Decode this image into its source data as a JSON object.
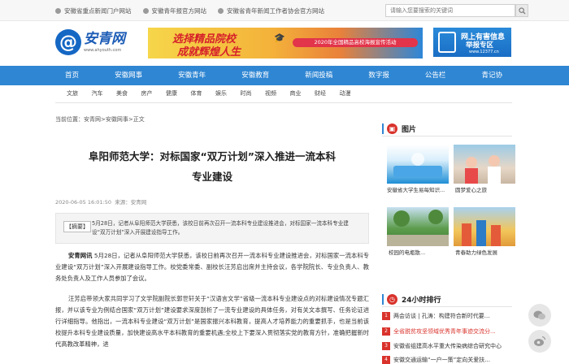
{
  "topbar": {
    "links": [
      {
        "label": "安徽省重点新闻门户网站"
      },
      {
        "label": "安徽青年报官方网站"
      },
      {
        "label": "安徽省青年新闻工作者协会官方网站"
      }
    ],
    "search_placeholder": "请输入您要搜索的关键词"
  },
  "header": {
    "logo_symbol": "@",
    "logo_text": "安青网",
    "logo_url": "www.ahyouth.com",
    "banner": {
      "line1": "选择精品院校",
      "line2": "成就辉煌人生",
      "sub": "2020年全国精品高校海报宣传活动"
    },
    "ad": {
      "line1": "网上有害信息",
      "line2": "举报专区",
      "url": "www.12377.cn"
    }
  },
  "nav": {
    "items": [
      "首页",
      "安徽网事",
      "安徽青年",
      "安徽教育",
      "新闻投稿",
      "数字报",
      "公告栏",
      "青记协"
    ]
  },
  "subnav": {
    "items": [
      "文旅",
      "汽车",
      "美食",
      "房产",
      "健康",
      "体育",
      "娱乐",
      "时尚",
      "视频",
      "商业",
      "财经",
      "动漫"
    ]
  },
  "breadcrumb": "当前位置：安青网>安徽网事>正文",
  "article": {
    "title_line1": "阜阳师范大学：对标国家“双万计划”深入推进一流本科",
    "title_line2": "专业建设",
    "date": "2020-06-05 16:01:50",
    "source": "来源：安青网",
    "abstract_tag": "【摘要】",
    "abstract": "5月28日，记者从阜阳师范大学获悉，该校日前再次召开一流本科专业建设推进会，对标国家一流本科专业建设“双万计划”深入开展建设指导工作。",
    "para1_lead": "安青网讯",
    "para1": " 5月28日，记者从阜阳师范大学获悉，该校日前再次召开一流本科专业建设推进会，对标国家一流本科专业建设“双万计划”深入开展建设指导工作。校党委常委、副校长汪芳启出席并主持会议，各学院院长、专业负责人、教务处负责人及工作人员参加了会议。",
    "para2": "汪芳启带领大家共同学习了文学院副院长郭世轩关于“汉语言文学”省级一流本科专业建设点的对标建设情况专题汇报，并以该专业为例结合国家“双万计划”建设要求深度剖析了一流专业建设的具体任务，对有关文本撰写、任务论证进行详细指导。他指出，一流本科专业建设“双万计划”是国家振兴本科教育，提高人才培养能力的重要抓手，也是当前该校提升本科专业建设质量，加快建设高水平本科教育的重要机遇;全校上下要深入贯彻落实党的教育方针，准确把握新时代高教改革精神，进"
  },
  "sidebar": {
    "pics_heading": "图片",
    "pics": [
      {
        "caption": "安徽省大学生易每知识..."
      },
      {
        "caption": "圆梦爱心之旅"
      },
      {
        "caption": "校园的电瓶散..."
      },
      {
        "caption": "青春助力绿色发展"
      }
    ],
    "rank_heading": "24小时排行",
    "rank": [
      {
        "num": "1",
        "text": "两会访谈 | 孔涛：构建符合新时代要..."
      },
      {
        "num": "2",
        "text": "全省脱贫攻坚领域优秀青年事迹交流分..."
      },
      {
        "num": "3",
        "text": "安徽省组建高水平重大传染病综合研究中心"
      },
      {
        "num": "4",
        "text": "安徽交通运输“一户一策”定向关爱扶..."
      }
    ]
  },
  "colors": {
    "nav_bg": "#2f86d3",
    "accent_red": "#d9322b",
    "logo_blue": "#1567c4"
  }
}
